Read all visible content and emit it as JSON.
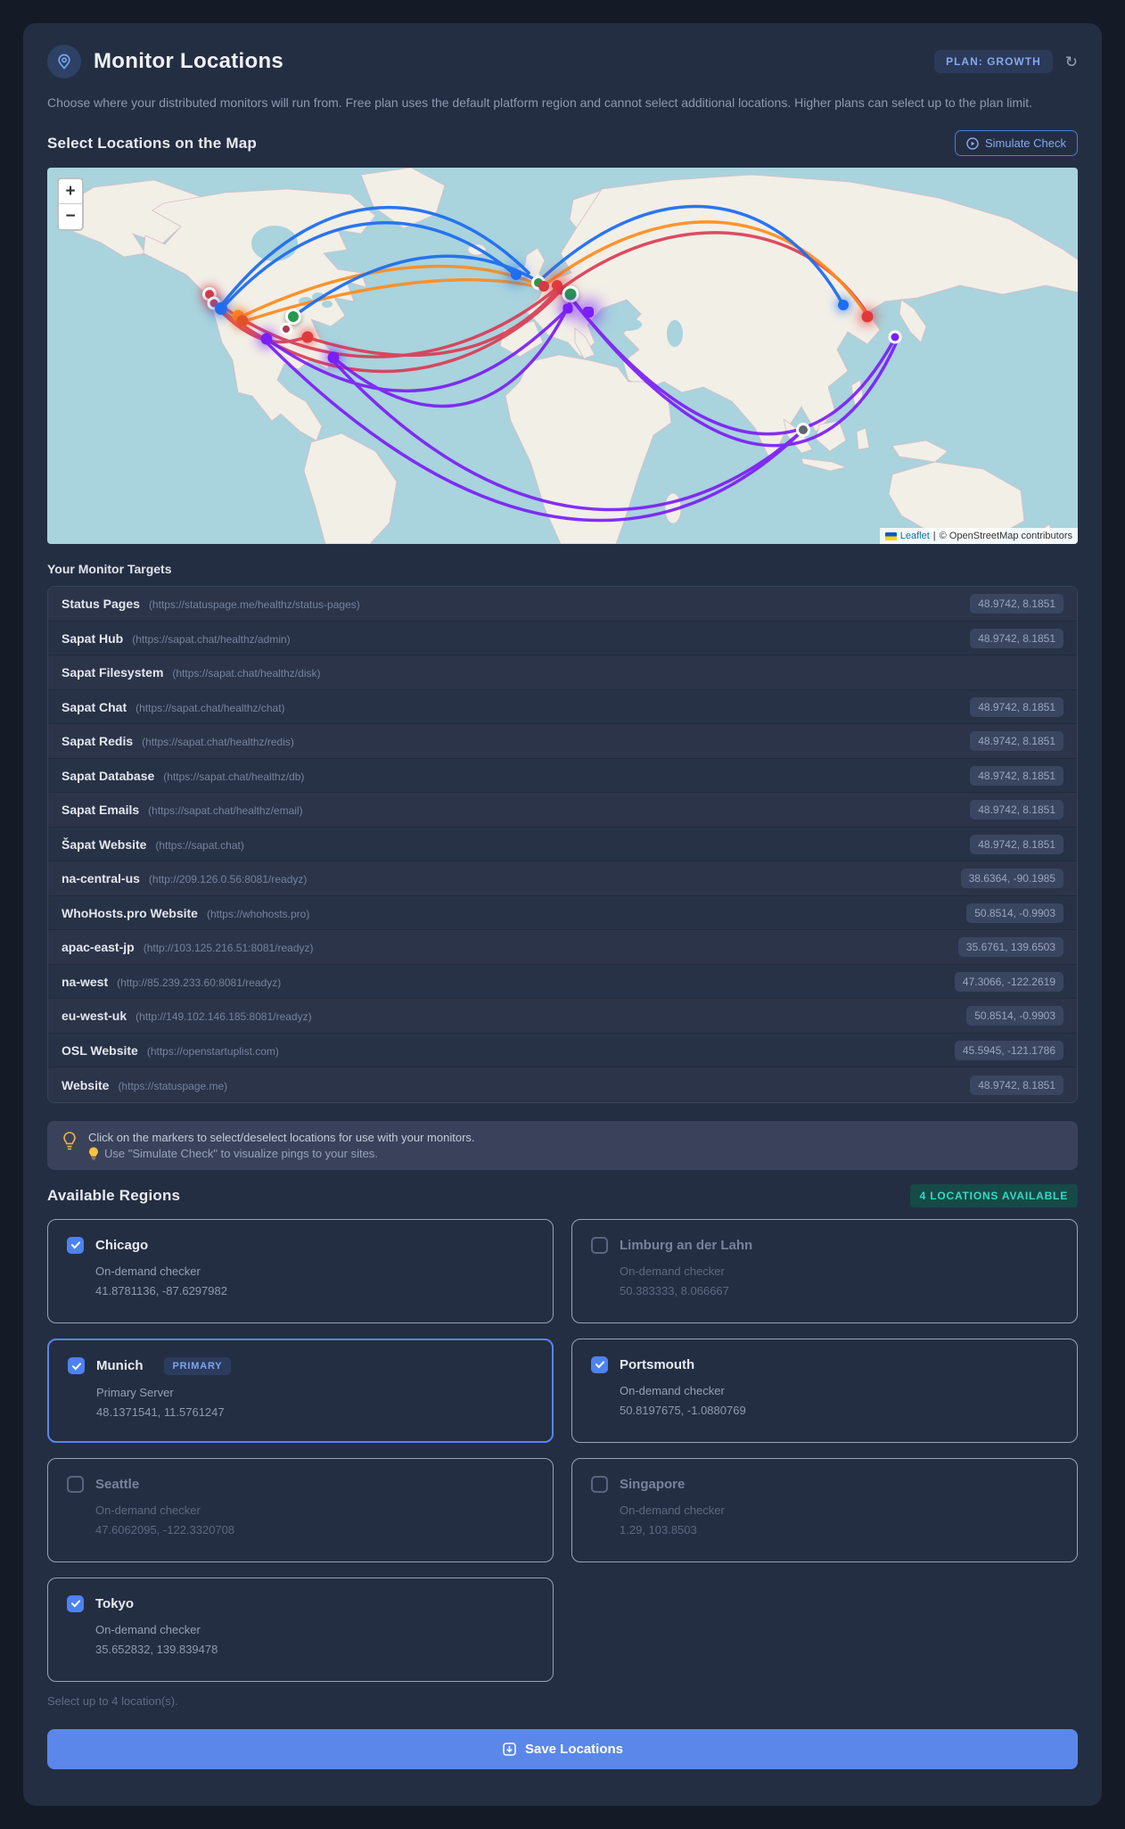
{
  "header": {
    "title": "Monitor Locations",
    "plan_badge": "PLAN: GROWTH",
    "description": "Choose where your distributed monitors will run from. Free plan uses the default platform region and cannot select additional locations. Higher plans can select up to the plan limit."
  },
  "map_section": {
    "heading": "Select Locations on the Map",
    "simulate_button": "Simulate Check",
    "zoom_in": "+",
    "zoom_out": "−",
    "attribution": {
      "leaflet": "Leaflet",
      "separator": "|",
      "osm": "© OpenStreetMap contributors"
    }
  },
  "targets": {
    "heading": "Your Monitor Targets",
    "items": [
      {
        "name": "Status Pages",
        "url": "(https://statuspage.me/healthz/status-pages)",
        "coords": "48.9742, 8.1851"
      },
      {
        "name": "Sapat Hub",
        "url": "(https://sapat.chat/healthz/admin)",
        "coords": "48.9742, 8.1851"
      },
      {
        "name": "Sapat Filesystem",
        "url": "(https://sapat.chat/healthz/disk)",
        "coords": ""
      },
      {
        "name": "Sapat Chat",
        "url": "(https://sapat.chat/healthz/chat)",
        "coords": "48.9742, 8.1851"
      },
      {
        "name": "Sapat Redis",
        "url": "(https://sapat.chat/healthz/redis)",
        "coords": "48.9742, 8.1851"
      },
      {
        "name": "Sapat Database",
        "url": "(https://sapat.chat/healthz/db)",
        "coords": "48.9742, 8.1851"
      },
      {
        "name": "Sapat Emails",
        "url": "(https://sapat.chat/healthz/email)",
        "coords": "48.9742, 8.1851"
      },
      {
        "name": "Šapat Website",
        "url": "(https://sapat.chat)",
        "coords": "48.9742, 8.1851"
      },
      {
        "name": "na-central-us",
        "url": "(http://209.126.0.56:8081/readyz)",
        "coords": "38.6364, -90.1985"
      },
      {
        "name": "WhoHosts.pro Website",
        "url": "(https://whohosts.pro)",
        "coords": "50.8514, -0.9903"
      },
      {
        "name": "apac-east-jp",
        "url": "(http://103.125.216.51:8081/readyz)",
        "coords": "35.6761, 139.6503"
      },
      {
        "name": "na-west",
        "url": "(http://85.239.233.60:8081/readyz)",
        "coords": "47.3066, -122.2619"
      },
      {
        "name": "eu-west-uk",
        "url": "(http://149.102.146.185:8081/readyz)",
        "coords": "50.8514, -0.9903"
      },
      {
        "name": "OSL Website",
        "url": "(https://openstartuplist.com)",
        "coords": "45.5945, -121.1786"
      },
      {
        "name": "Website",
        "url": "(https://statuspage.me)",
        "coords": "48.9742, 8.1851"
      }
    ]
  },
  "tip": {
    "line1": "Click on the markers to select/deselect locations for use with your monitors.",
    "line2": "Use \"Simulate Check\" to visualize pings to your sites."
  },
  "regions": {
    "heading": "Available Regions",
    "badge": "4 LOCATIONS AVAILABLE",
    "primary_label": "PRIMARY",
    "cards": [
      {
        "name": "Chicago",
        "sub": "On-demand checker",
        "coords": "41.8781136, -87.6297982"
      },
      {
        "name": "Limburg an der Lahn",
        "sub": "On-demand checker",
        "coords": "50.383333, 8.066667"
      },
      {
        "name": "Munich",
        "sub": "Primary Server",
        "coords": "48.1371541, 11.5761247"
      },
      {
        "name": "Portsmouth",
        "sub": "On-demand checker",
        "coords": "50.8197675, -1.0880769"
      },
      {
        "name": "Seattle",
        "sub": "On-demand checker",
        "coords": "47.6062095, -122.3320708"
      },
      {
        "name": "Singapore",
        "sub": "On-demand checker",
        "coords": "1.29, 103.8503"
      },
      {
        "name": "Tokyo",
        "sub": "On-demand checker",
        "coords": "35.652832, 139.839478"
      }
    ],
    "hint": "Select up to 4 location(s)."
  },
  "footer": {
    "save_label": "Save Locations"
  }
}
